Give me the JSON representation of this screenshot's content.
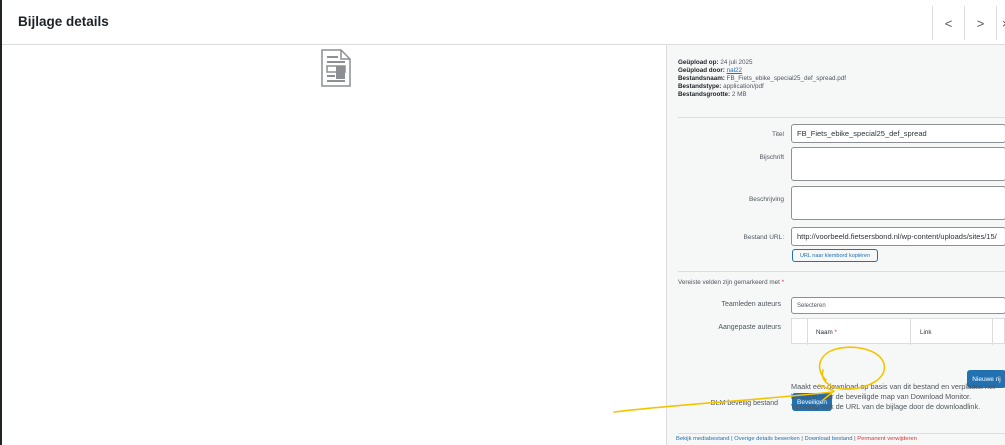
{
  "header": {
    "title": "Bijlage details",
    "prev_glyph": "<",
    "next_glyph": ">",
    "close_glyph": "×"
  },
  "preview": {
    "icon": "document-icon"
  },
  "meta": {
    "uploaded_on_label": "Geüpload op:",
    "uploaded_on": "24 juli 2025",
    "uploaded_by_label": "Geüpload door:",
    "uploaded_by": "nal22",
    "filename_label": "Bestandsnaam:",
    "filename": "FB_Fiets_ebike_special25_def_spread.pdf",
    "filetype_label": "Bestandstype:",
    "filetype": "application/pdf",
    "filesize_label": "Bestandsgrootte:",
    "filesize": "2 MB"
  },
  "fields": {
    "title_label": "Titel",
    "title_value": "FB_Fiets_ebike_special25_def_spread",
    "caption_label": "Bijschrift",
    "description_label": "Beschrijving",
    "url_label": "Bestand URL:",
    "url_value": "http://voorbeeld.fietsersbond.nl/wp-content/uploads/sites/15/",
    "copy_url_button": "URL naar klembord kopiëren"
  },
  "required_note": {
    "text": "Vereiste velden zijn gemarkeerd met",
    "marker": "*"
  },
  "authors": {
    "team_label": "Teamleden auteurs",
    "team_placeholder": "Selecteren",
    "custom_label": "Aangepaste auteurs",
    "col_name": "Naam",
    "col_name_required": "*",
    "col_link": "Link",
    "new_row_button": "Nieuwe rij"
  },
  "dlm": {
    "label": "DLM beveilig bestand",
    "button": "Beveiligen",
    "description": "Maakt een download op basis van dit bestand en verplaatst het bestand naar de beveiligde map van Download Monitor. Vervangt ook de URL van de bijlage door de downloadlink."
  },
  "footer": {
    "view": "Bekijk mediabestand",
    "edit": "Overige details bewerken",
    "download": "Download bestand",
    "delete": "Permanent verwijderen",
    "separator": "|"
  },
  "colors": {
    "accent": "#2271b1",
    "danger": "#d63638",
    "annotation": "#f5c400"
  }
}
